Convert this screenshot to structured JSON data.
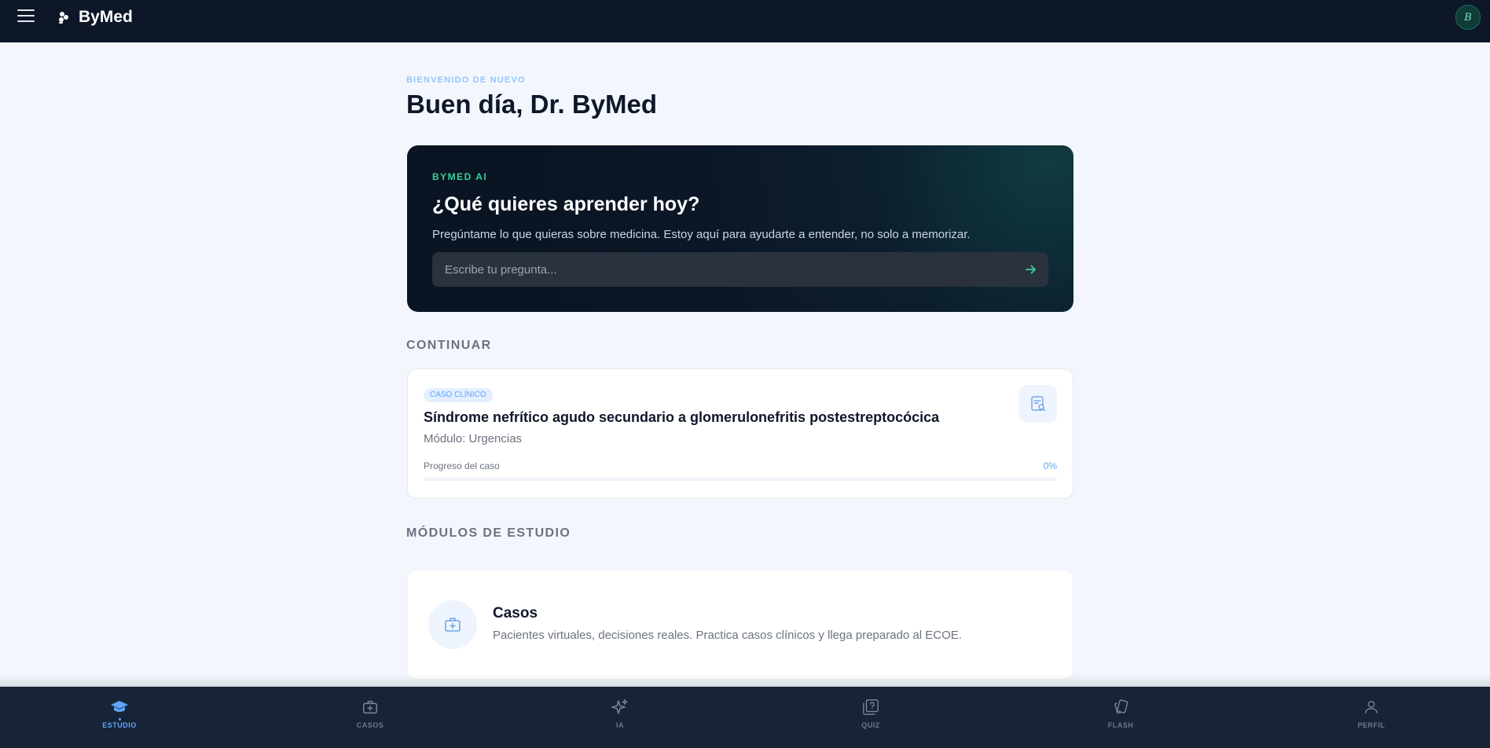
{
  "app": {
    "title": "ByMed",
    "avatar_initial": "B"
  },
  "hero": {
    "eyebrow": "BIENVENIDO DE NUEVO",
    "greeting": "Buen día, Dr. ByMed"
  },
  "ai_card": {
    "label": "BYMED AI",
    "title": "¿Qué quieres aprender hoy?",
    "description": "Pregúntame lo que quieras sobre medicina. Estoy aquí para ayudarte a entender, no solo a memorizar.",
    "input_placeholder": "Escribe tu pregunta...",
    "input_value": ""
  },
  "continue_section": {
    "title": "CONTINUAR",
    "card": {
      "badge": "CASO CLÍNICO",
      "title": "Síndrome nefrítico agudo secundario a glomerulonefritis postestreptocócica",
      "module": "Módulo: Urgencias",
      "progress_label": "Progreso del caso",
      "progress_text": "0%",
      "progress_value": 0
    }
  },
  "modules_section": {
    "title": "MÓDULOS DE ESTUDIO",
    "items": [
      {
        "title": "Casos",
        "description": "Pacientes virtuales, decisiones reales. Practica casos clínicos y llega preparado al ECOE.",
        "icon": "medical-kit-icon"
      }
    ]
  },
  "bottom_nav": {
    "items": [
      {
        "label": "ESTUDIO",
        "icon": "graduation-cap-icon",
        "active": true
      },
      {
        "label": "CASOS",
        "icon": "medical-kit-icon",
        "active": false
      },
      {
        "label": "IA",
        "icon": "sparkles-icon",
        "active": false
      },
      {
        "label": "QUIZ",
        "icon": "quiz-icon",
        "active": false
      },
      {
        "label": "FLASH",
        "icon": "cards-icon",
        "active": false
      },
      {
        "label": "PERFIL",
        "icon": "user-icon",
        "active": false
      }
    ]
  },
  "colors": {
    "topbar": "#0d1728",
    "accent": "#60a5fa",
    "ai_accent": "#34d399",
    "background": "#f3f7fd",
    "bottom_nav": "#172336"
  }
}
